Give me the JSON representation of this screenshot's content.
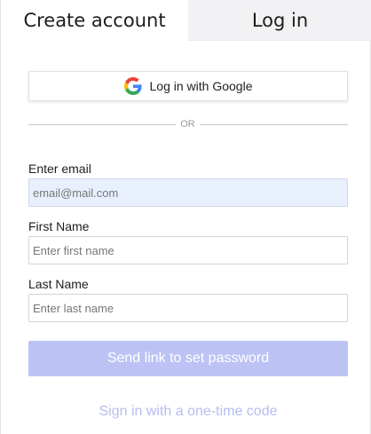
{
  "tabs": {
    "create_account": "Create account",
    "log_in": "Log in"
  },
  "google": {
    "label": "Log in with Google",
    "icon": "google-icon"
  },
  "divider": {
    "text": "OR"
  },
  "email": {
    "label": "Enter email",
    "value": "",
    "placeholder": "email@mail.com"
  },
  "first_name": {
    "label": "First Name",
    "value": "",
    "placeholder": "Enter first name"
  },
  "last_name": {
    "label": "Last Name",
    "value": "",
    "placeholder": "Enter last name"
  },
  "send_button": {
    "label": "Send link to set password"
  },
  "one_time_code_link": {
    "label": "Sign in with a one-time code"
  },
  "colors": {
    "primary_disabled": "#bcc3f4",
    "link": "#b6bdee",
    "autofill_bg": "#e8f0fe",
    "inactive_tab_bg": "#f2f2f4"
  }
}
